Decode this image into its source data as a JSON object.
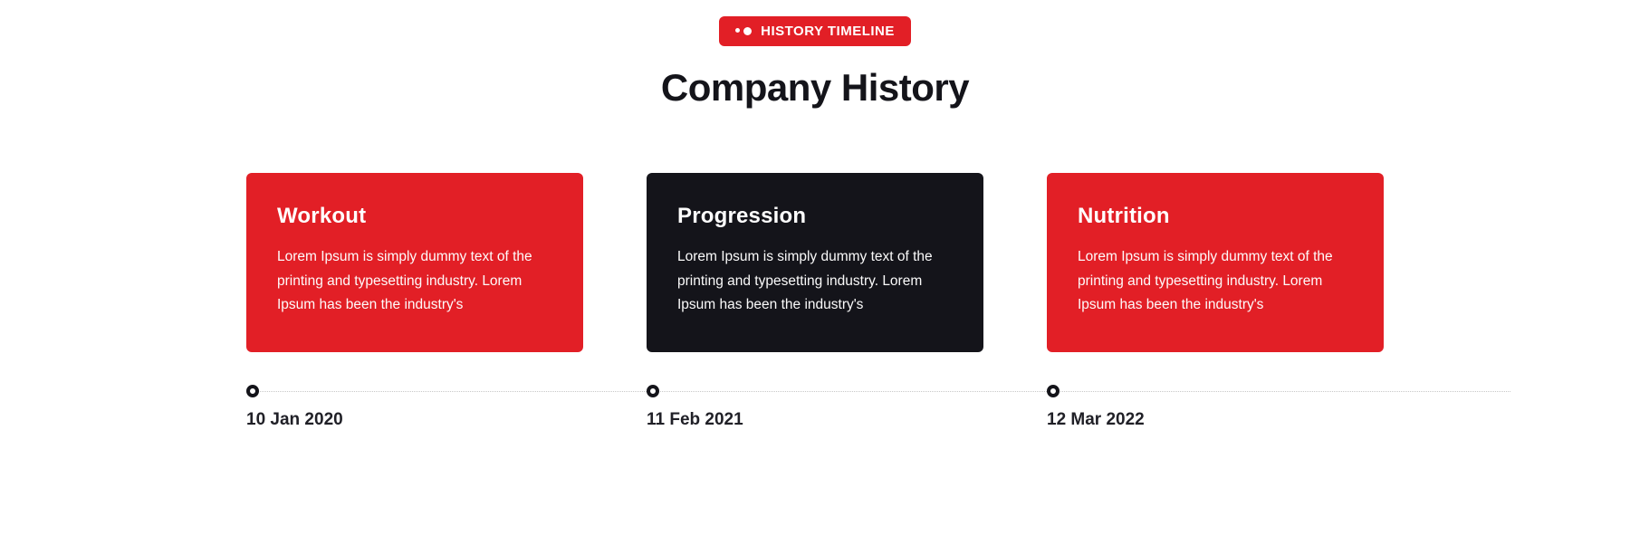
{
  "badge_label": "HISTORY TIMELINE",
  "heading": "Company History",
  "cards": [
    {
      "title": "Workout",
      "text": "Lorem Ipsum is simply dummy text of the printing and typesetting industry. Lorem Ipsum has been the industry's",
      "variant": "red"
    },
    {
      "title": "Progression",
      "text": "Lorem Ipsum is simply dummy text of the printing and typesetting industry. Lorem Ipsum has been the industry's",
      "variant": "black"
    },
    {
      "title": "Nutrition",
      "text": "Lorem Ipsum is simply dummy text of the printing and typesetting industry. Lorem Ipsum has been the industry's",
      "variant": "red"
    }
  ],
  "dates": [
    "10 Jan 2020",
    "11 Feb 2021",
    "12 Mar 2022"
  ],
  "colors": {
    "brand_red": "#e21f26",
    "brand_black": "#14141a"
  }
}
